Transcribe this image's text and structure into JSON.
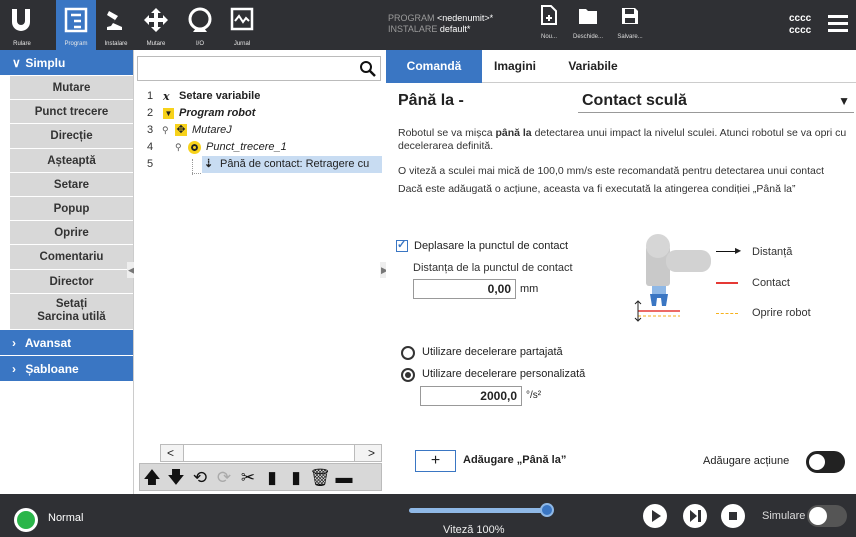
{
  "topbar": {
    "nav": [
      {
        "label": "Rulare",
        "icon": "ur-logo-icon"
      },
      {
        "label": "Program",
        "icon": "program-icon"
      },
      {
        "label": "Instalare",
        "icon": "installation-icon"
      },
      {
        "label": "Mutare",
        "icon": "move-icon"
      },
      {
        "label": "I/O",
        "icon": "io-icon"
      },
      {
        "label": "Jurnal",
        "icon": "log-icon"
      }
    ],
    "program_label": "PROGRAM",
    "program_value": "<nedenumit>*",
    "installation_label": "INSTALARE",
    "installation_value": "default*",
    "file_buttons": [
      {
        "label": "Nou...",
        "icon": "new-file-icon"
      },
      {
        "label": "Deschide...",
        "icon": "open-folder-icon"
      },
      {
        "label": "Salvare...",
        "icon": "save-icon"
      }
    ],
    "robot_name_1": "cccc",
    "robot_name_2": "cccc"
  },
  "sidebar": {
    "simplu": "Simplu",
    "items": [
      "Mutare",
      "Punct trecere",
      "Direcție",
      "Așteaptă",
      "Setare",
      "Popup",
      "Oprire",
      "Comentariu",
      "Director"
    ],
    "payload_line1": "Setați",
    "payload_line2": "Sarcina utilă",
    "avansat": "Avansat",
    "sabloane": "Șabloane"
  },
  "tree": {
    "search_placeholder": "",
    "lines": [
      {
        "num": "1",
        "text": "Setare variabile"
      },
      {
        "num": "2",
        "text": "Program robot"
      },
      {
        "num": "3",
        "text": "MutareJ"
      },
      {
        "num": "4",
        "text": "Punct_trecere_1"
      },
      {
        "num": "5",
        "text": "Până de contact: Retragere cu"
      }
    ]
  },
  "tabs": [
    "Comandă",
    "Imagini",
    "Variabile"
  ],
  "command": {
    "title": "Până la -",
    "dropdown_value": "Contact sculă",
    "desc1_pre": "Robotul se va mișca ",
    "desc1_bold": "până la",
    "desc1_post": " detectarea unui impact la nivelul sculei. Atunci robotul se va opri cu decelerarea definită.",
    "desc2": "O viteză a sculei mai mică de 100,0 mm/s este recomandată pentru detectarea unui contact",
    "desc3": "Dacă este adăugată o acțiune, aceasta va fi executată la atingerea condiției „Până la”",
    "checkbox_label": "Deplasare la punctul de contact",
    "distance_label": "Distanța de la punctul de contact",
    "distance_value": "0,00",
    "distance_unit": "mm",
    "legend": [
      "Distanță",
      "Contact",
      "Oprire robot"
    ],
    "radio_shared": "Utilizare decelerare partajată",
    "radio_custom": "Utilizare decelerare personalizată",
    "decel_value": "2000,0",
    "decel_unit": "°/s²",
    "add_button_plus": "+",
    "add_button_label": "Adăugare „Până la”",
    "add_action_label": "Adăugare acțiune"
  },
  "bottom": {
    "status": "Normal",
    "speed_label": "Viteză 100%",
    "speed_fraction": 1.0,
    "sim_label": "Simulare"
  },
  "colors": {
    "accent": "#3a76c3",
    "dark": "#2f3034",
    "status_green": "#2bb64a",
    "contact_red": "#e53935",
    "stop_yellow": "#f6b11c"
  }
}
